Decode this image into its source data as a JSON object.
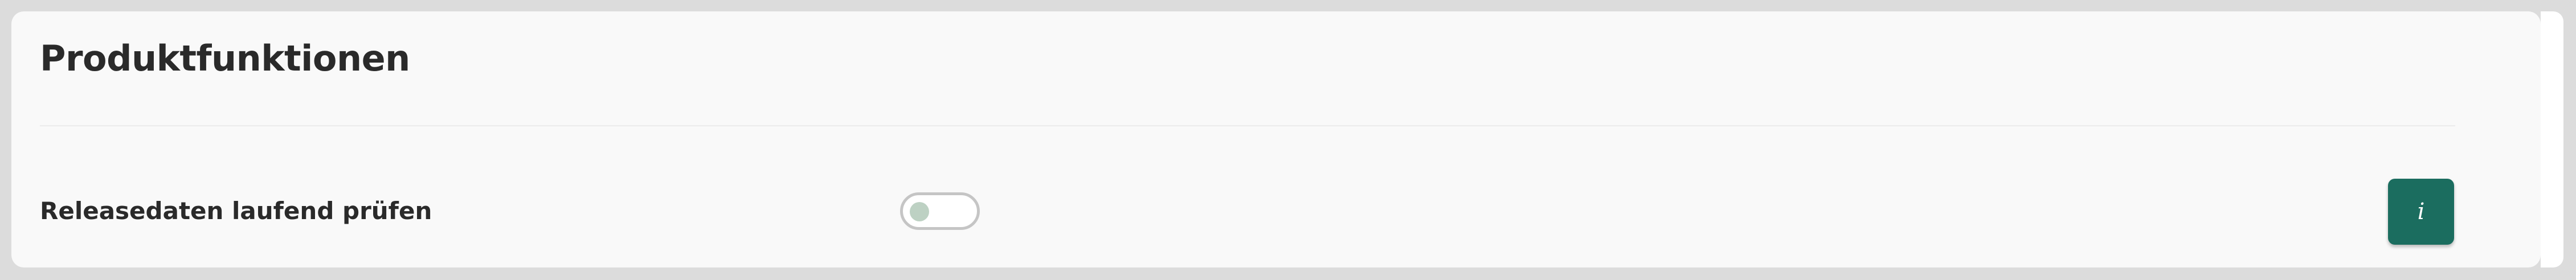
{
  "section": {
    "title": "Produktfunktionen"
  },
  "features": [
    {
      "label": "Releasedaten laufend prüfen",
      "enabled": false,
      "info_button": {
        "icon": "info-icon",
        "glyph": "i"
      }
    }
  ],
  "colors": {
    "background": "#dcdcdc",
    "panel": "#f9f9f9",
    "accent": "#1b6d5f",
    "toggle_border": "#c5c5c5",
    "toggle_knob_off": "#bdd1c3",
    "text": "#2a2a2a"
  }
}
